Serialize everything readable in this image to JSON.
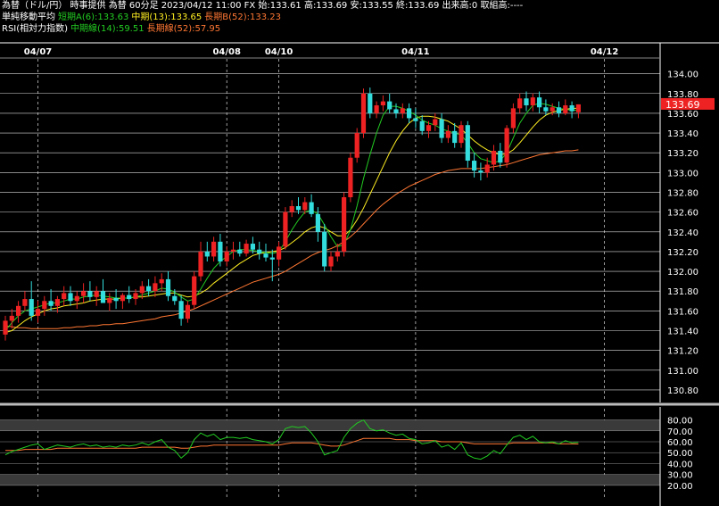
{
  "header": {
    "line1": "為替（ドル/円） 時事提供 為替 60分足 2023/04/12 11:00 FX 始:133.61 高:133.69 安:133.55 終:133.69 出来高:0 取組高:----",
    "ma_title": "単純移動平均",
    "ma_short": "短期A(6):133.63",
    "ma_mid": "中期(13):133.65",
    "ma_long": "長期B(52):133.23",
    "rsi_title": "RSI(相対力指数)",
    "rsi_mid": "中期線(14):59.51",
    "rsi_long": "長期線(52):57.95"
  },
  "colors": {
    "up": "#ee2222",
    "down": "#33dddd",
    "ma_short": "#22cc22",
    "ma_mid": "#ffee22",
    "ma_long": "#ff7733",
    "grid": "#ffffff",
    "price_tag_bg": "#ee2222"
  },
  "price_tag": "133.69",
  "chart_data": [
    {
      "type": "candlestick",
      "title": "為替（ドル/円）60分足",
      "date_labels": [
        {
          "label": "04/07",
          "index": 5
        },
        {
          "label": "04/08",
          "index": 34
        },
        {
          "label": "04/10",
          "index": 42
        },
        {
          "label": "04/11",
          "index": 63
        },
        {
          "label": "04/12",
          "index": 92
        }
      ],
      "y_ticks": [
        "134.00",
        "133.80",
        "133.60",
        "133.40",
        "133.20",
        "133.00",
        "132.80",
        "132.60",
        "132.40",
        "132.20",
        "132.00",
        "131.80",
        "131.60",
        "131.40",
        "131.20",
        "131.00",
        "130.80"
      ],
      "ylim": [
        130.7,
        134.15
      ],
      "current_price": 133.69,
      "ohlc": [
        [
          131.36,
          131.55,
          131.3,
          131.5
        ],
        [
          131.5,
          131.62,
          131.42,
          131.55
        ],
        [
          131.55,
          131.7,
          131.48,
          131.65
        ],
        [
          131.65,
          131.8,
          131.6,
          131.72
        ],
        [
          131.72,
          131.9,
          131.5,
          131.55
        ],
        [
          131.55,
          131.7,
          131.48,
          131.62
        ],
        [
          131.62,
          131.75,
          131.55,
          131.7
        ],
        [
          131.7,
          131.82,
          131.6,
          131.65
        ],
        [
          131.65,
          131.75,
          131.58,
          131.72
        ],
        [
          131.72,
          131.85,
          131.65,
          131.78
        ],
        [
          131.78,
          131.85,
          131.65,
          131.7
        ],
        [
          131.7,
          131.8,
          131.62,
          131.75
        ],
        [
          131.75,
          131.88,
          131.68,
          131.8
        ],
        [
          131.8,
          131.9,
          131.7,
          131.74
        ],
        [
          131.74,
          131.85,
          131.65,
          131.8
        ],
        [
          131.8,
          131.92,
          131.72,
          131.68
        ],
        [
          131.68,
          131.78,
          131.6,
          131.73
        ],
        [
          131.73,
          131.82,
          131.62,
          131.7
        ],
        [
          131.7,
          131.78,
          131.62,
          131.76
        ],
        [
          131.76,
          131.85,
          131.68,
          131.72
        ],
        [
          131.72,
          131.82,
          131.66,
          131.78
        ],
        [
          131.78,
          131.9,
          131.72,
          131.85
        ],
        [
          131.85,
          131.92,
          131.75,
          131.8
        ],
        [
          131.8,
          131.95,
          131.74,
          131.88
        ],
        [
          131.88,
          131.98,
          131.8,
          131.92
        ],
        [
          131.92,
          132.0,
          131.7,
          131.75
        ],
        [
          131.75,
          131.82,
          131.66,
          131.7
        ],
        [
          131.7,
          131.76,
          131.45,
          131.52
        ],
        [
          131.52,
          131.7,
          131.48,
          131.66
        ],
        [
          131.66,
          132.0,
          131.62,
          131.95
        ],
        [
          131.95,
          132.3,
          131.9,
          132.2
        ],
        [
          132.2,
          132.3,
          132.1,
          132.15
        ],
        [
          132.15,
          132.35,
          132.1,
          132.3
        ],
        [
          132.3,
          132.38,
          132.05,
          132.1
        ],
        [
          132.1,
          132.25,
          132.05,
          132.2
        ],
        [
          132.2,
          132.3,
          132.12,
          132.22
        ],
        [
          132.22,
          132.3,
          132.15,
          132.18
        ],
        [
          132.18,
          132.32,
          132.15,
          132.28
        ],
        [
          132.28,
          132.35,
          132.18,
          132.22
        ],
        [
          132.22,
          132.3,
          132.12,
          132.18
        ],
        [
          132.18,
          132.28,
          132.1,
          132.14
        ],
        [
          132.14,
          132.22,
          131.9,
          132.12
        ],
        [
          132.12,
          132.3,
          132.05,
          132.25
        ],
        [
          132.25,
          132.65,
          132.22,
          132.6
        ],
        [
          132.6,
          132.72,
          132.55,
          132.66
        ],
        [
          132.66,
          132.75,
          132.58,
          132.62
        ],
        [
          132.62,
          132.75,
          132.58,
          132.7
        ],
        [
          132.7,
          132.78,
          132.55,
          132.58
        ],
        [
          132.58,
          132.65,
          132.3,
          132.4
        ],
        [
          132.4,
          132.48,
          132.0,
          132.05
        ],
        [
          132.05,
          132.2,
          132.0,
          132.15
        ],
        [
          132.15,
          132.28,
          132.1,
          132.2
        ],
        [
          132.2,
          132.8,
          132.15,
          132.75
        ],
        [
          132.75,
          133.2,
          132.7,
          133.15
        ],
        [
          133.15,
          133.45,
          133.1,
          133.4
        ],
        [
          133.4,
          133.85,
          133.35,
          133.8
        ],
        [
          133.8,
          133.86,
          133.55,
          133.6
        ],
        [
          133.6,
          133.72,
          133.55,
          133.68
        ],
        [
          133.68,
          133.78,
          133.62,
          133.72
        ],
        [
          133.72,
          133.8,
          133.6,
          133.64
        ],
        [
          133.64,
          133.7,
          133.55,
          133.6
        ],
        [
          133.6,
          133.7,
          133.55,
          133.65
        ],
        [
          133.65,
          133.7,
          133.5,
          133.55
        ],
        [
          133.55,
          133.65,
          133.45,
          133.52
        ],
        [
          133.52,
          133.58,
          133.38,
          133.42
        ],
        [
          133.42,
          133.52,
          133.35,
          133.48
        ],
        [
          133.48,
          133.6,
          133.42,
          133.54
        ],
        [
          133.54,
          133.6,
          133.3,
          133.35
        ],
        [
          133.35,
          133.48,
          133.3,
          133.42
        ],
        [
          133.42,
          133.5,
          133.25,
          133.3
        ],
        [
          133.3,
          133.52,
          133.25,
          133.48
        ],
        [
          133.48,
          133.52,
          133.05,
          133.12
        ],
        [
          133.12,
          133.2,
          132.95,
          133.02
        ],
        [
          133.02,
          133.1,
          132.92,
          133.0
        ],
        [
          133.0,
          133.15,
          132.95,
          133.08
        ],
        [
          133.08,
          133.28,
          133.02,
          133.22
        ],
        [
          133.22,
          133.3,
          133.05,
          133.1
        ],
        [
          133.1,
          133.48,
          133.05,
          133.45
        ],
        [
          133.45,
          133.7,
          133.4,
          133.65
        ],
        [
          133.65,
          133.8,
          133.6,
          133.75
        ],
        [
          133.75,
          133.82,
          133.62,
          133.68
        ],
        [
          133.68,
          133.8,
          133.62,
          133.76
        ],
        [
          133.76,
          133.82,
          133.6,
          133.66
        ],
        [
          133.66,
          133.74,
          133.58,
          133.62
        ],
        [
          133.62,
          133.7,
          133.58,
          133.66
        ],
        [
          133.66,
          133.72,
          133.56,
          133.6
        ],
        [
          133.6,
          133.74,
          133.58,
          133.68
        ],
        [
          133.68,
          133.72,
          133.55,
          133.62
        ],
        [
          133.61,
          133.69,
          133.55,
          133.69
        ]
      ],
      "ma_short": [
        131.4,
        131.48,
        131.55,
        131.6,
        131.62,
        131.64,
        131.66,
        131.68,
        131.68,
        131.7,
        131.72,
        131.72,
        131.74,
        131.75,
        131.76,
        131.75,
        131.74,
        131.73,
        131.73,
        131.73,
        131.74,
        131.76,
        131.78,
        131.8,
        131.83,
        131.82,
        131.79,
        131.74,
        131.7,
        131.72,
        131.82,
        131.93,
        132.03,
        132.1,
        132.15,
        132.2,
        132.22,
        132.22,
        132.21,
        132.2,
        132.19,
        132.18,
        132.2,
        132.3,
        132.42,
        132.52,
        132.6,
        132.62,
        132.58,
        132.47,
        132.35,
        132.25,
        132.27,
        132.42,
        132.66,
        132.94,
        133.18,
        133.4,
        133.58,
        133.67,
        133.67,
        133.65,
        133.62,
        133.58,
        133.53,
        133.5,
        133.48,
        133.44,
        133.42,
        133.4,
        133.38,
        133.3,
        133.2,
        133.14,
        133.12,
        133.1,
        133.12,
        133.2,
        133.35,
        133.5,
        133.6,
        133.68,
        133.7,
        133.69,
        133.67,
        133.65,
        133.64,
        133.63,
        133.63
      ],
      "ma_mid": [
        131.38,
        131.4,
        131.45,
        131.5,
        131.54,
        131.57,
        131.6,
        131.62,
        131.63,
        131.65,
        131.66,
        131.67,
        131.68,
        131.7,
        131.71,
        131.72,
        131.72,
        131.72,
        131.73,
        131.73,
        131.74,
        131.74,
        131.75,
        131.76,
        131.77,
        131.78,
        131.78,
        131.76,
        131.74,
        131.75,
        131.78,
        131.82,
        131.88,
        131.93,
        131.98,
        132.03,
        132.08,
        132.12,
        132.16,
        132.18,
        132.19,
        132.2,
        132.21,
        132.24,
        132.29,
        132.34,
        132.4,
        132.44,
        132.46,
        132.44,
        132.4,
        132.36,
        132.36,
        132.42,
        132.52,
        132.64,
        132.78,
        132.92,
        133.06,
        133.2,
        133.32,
        133.42,
        133.5,
        133.55,
        133.57,
        133.57,
        133.56,
        133.54,
        133.52,
        133.48,
        133.44,
        133.38,
        133.32,
        133.27,
        133.23,
        133.2,
        133.18,
        133.19,
        133.23,
        133.3,
        133.38,
        133.46,
        133.53,
        133.58,
        133.61,
        133.63,
        133.64,
        133.65,
        133.65
      ],
      "ma_long": [
        131.45,
        131.44,
        131.43,
        131.43,
        131.42,
        131.42,
        131.42,
        131.42,
        131.42,
        131.43,
        131.43,
        131.44,
        131.44,
        131.45,
        131.45,
        131.46,
        131.46,
        131.47,
        131.47,
        131.48,
        131.49,
        131.5,
        131.51,
        131.52,
        131.54,
        131.55,
        131.56,
        131.58,
        131.6,
        131.62,
        131.65,
        131.68,
        131.71,
        131.74,
        131.77,
        131.8,
        131.83,
        131.86,
        131.89,
        131.91,
        131.93,
        131.95,
        131.97,
        132.0,
        132.04,
        132.08,
        132.12,
        132.16,
        132.19,
        132.21,
        132.23,
        132.26,
        132.3,
        132.35,
        132.41,
        132.48,
        132.55,
        132.62,
        132.68,
        132.73,
        132.78,
        132.82,
        132.86,
        132.89,
        132.92,
        132.95,
        132.98,
        133.0,
        133.02,
        133.03,
        133.04,
        133.04,
        133.04,
        133.04,
        133.05,
        133.06,
        133.07,
        133.08,
        133.1,
        133.12,
        133.14,
        133.16,
        133.18,
        133.19,
        133.2,
        133.21,
        133.22,
        133.22,
        133.23
      ]
    },
    {
      "type": "line",
      "title": "RSI(相対力指数)",
      "y_ticks": [
        "80.00",
        "70.00",
        "60.00",
        "50.00",
        "40.00",
        "30.00",
        "20.00"
      ],
      "ylim": [
        15,
        87
      ],
      "bands": [
        [
          20,
          30
        ],
        [
          70,
          80
        ]
      ],
      "series": [
        {
          "name": "中期線(14)",
          "values": [
            48,
            51,
            53,
            55,
            57,
            58,
            53,
            55,
            57,
            56,
            55,
            57,
            58,
            56,
            57,
            55,
            56,
            55,
            57,
            56,
            57,
            59,
            57,
            60,
            62,
            55,
            52,
            45,
            50,
            62,
            68,
            65,
            67,
            62,
            64,
            64,
            63,
            64,
            62,
            61,
            60,
            58,
            62,
            72,
            74,
            73,
            74,
            68,
            60,
            48,
            50,
            52,
            64,
            72,
            77,
            80,
            72,
            70,
            71,
            68,
            66,
            67,
            63,
            62,
            58,
            59,
            61,
            55,
            57,
            53,
            59,
            48,
            45,
            44,
            47,
            52,
            49,
            57,
            64,
            66,
            62,
            65,
            60,
            59,
            60,
            58,
            61,
            59,
            59.51
          ]
        },
        {
          "name": "長期線(52)",
          "values": [
            52,
            52,
            52,
            53,
            53,
            53,
            53,
            53,
            54,
            54,
            54,
            54,
            54,
            54,
            54,
            54,
            54,
            54,
            54,
            54,
            54,
            55,
            55,
            55,
            55,
            55,
            55,
            54,
            54,
            55,
            56,
            56,
            57,
            57,
            57,
            57,
            57,
            57,
            57,
            57,
            57,
            57,
            57,
            58,
            59,
            59,
            59,
            59,
            58,
            57,
            56,
            56,
            57,
            59,
            61,
            63,
            63,
            63,
            63,
            63,
            62,
            62,
            62,
            61,
            61,
            61,
            61,
            60,
            60,
            60,
            60,
            59,
            58,
            58,
            58,
            58,
            58,
            58,
            59,
            59,
            59,
            59,
            59,
            59,
            59,
            58,
            58,
            58,
            57.95
          ]
        }
      ]
    }
  ]
}
